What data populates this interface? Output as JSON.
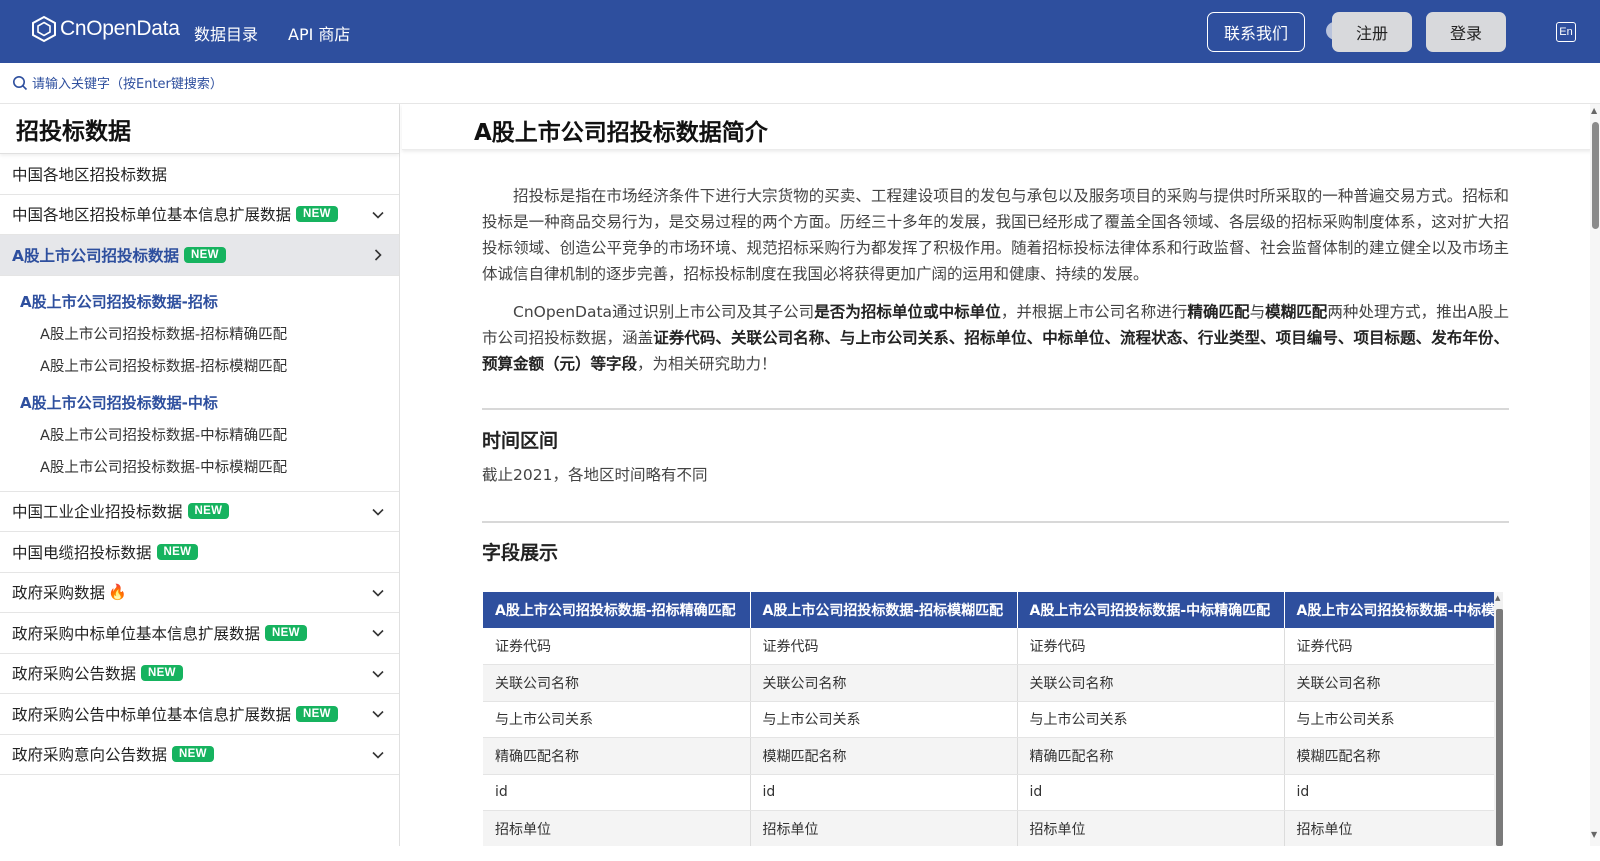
{
  "header": {
    "logo_text": "CnOpenData",
    "nav": [
      "数据目录",
      "API 商店"
    ],
    "contact_label": "联系我们",
    "register_label": "注册",
    "login_label": "登录",
    "lang_label": "En"
  },
  "search": {
    "placeholder": "请输入关键字（按Enter键搜索）"
  },
  "sidebar": {
    "title": "招投标数据",
    "badge": "NEW",
    "items": [
      {
        "label": "中国各地区招投标数据"
      },
      {
        "label": "中国各地区招投标单位基本信息扩展数据"
      },
      {
        "label": "A股上市公司招投标数据"
      },
      {
        "label": "中国工业企业招投标数据"
      },
      {
        "label": "中国电缆招投标数据"
      },
      {
        "label": "政府采购数据"
      },
      {
        "label": "政府采购中标单位基本信息扩展数据"
      },
      {
        "label": "政府采购公告数据"
      },
      {
        "label": "政府采购公告中标单位基本信息扩展数据"
      },
      {
        "label": "政府采购意向公告数据"
      }
    ],
    "submenu": {
      "group1": "A股上市公司招投标数据-招标",
      "group1_leaves": [
        "A股上市公司招投标数据-招标精确匹配",
        "A股上市公司招投标数据-招标模糊匹配"
      ],
      "group2": "A股上市公司招投标数据-中标",
      "group2_leaves": [
        "A股上市公司招投标数据-中标精确匹配",
        "A股上市公司招投标数据-中标模糊匹配"
      ]
    }
  },
  "main": {
    "title": "A股上市公司招投标数据简介",
    "para1": "招投标是指在市场经济条件下进行大宗货物的买卖、工程建设项目的发包与承包以及服务项目的采购与提供时所采取的一种普遍交易方式。招标和投标是一种商品交易行为，是交易过程的两个方面。历经三十多年的发展，我国已经形成了覆盖全国各领域、各层级的招标采购制度体系，这对扩大招投标领域、创造公平竞争的市场环境、规范招标采购行为都发挥了积极作用。随着招标投标法律体系和行政监督、社会监督体制的建立健全以及市场主体诚信自律机制的逐步完善，招标投标制度在我国必将获得更加广阔的运用和健康、持续的发展。",
    "para2": {
      "t1": "CnOpenData通过识别上市公司及其子公司",
      "b1": "是否为招标单位或中标单位",
      "t2": "，并根据上市公司名称进行",
      "b2": "精确匹配",
      "t3": "与",
      "b3": "模糊匹配",
      "t4": "两种处理方式，推出A股上市公司招投标数据，涵盖",
      "b4": "证券代码、关联公司名称、与上市公司关系、招标单位、中标单位、流程状态、行业类型、项目编号、项目标题、发布年份、预算金额（元）等字段",
      "t5": "，为相关研究助力！"
    },
    "time_heading": "时间区间",
    "time_text": "截止2021，各地区时间略有不同",
    "fields_heading": "字段展示",
    "table": {
      "headers": [
        "A股上市公司招投标数据-招标精确匹配",
        "A股上市公司招投标数据-招标模糊匹配",
        "A股上市公司招投标数据-中标精确匹配",
        "A股上市公司招投标数据-中标模糊匹配"
      ],
      "rows": [
        [
          "证券代码",
          "证券代码",
          "证券代码",
          "证券代码"
        ],
        [
          "关联公司名称",
          "关联公司名称",
          "关联公司名称",
          "关联公司名称"
        ],
        [
          "与上市公司关系",
          "与上市公司关系",
          "与上市公司关系",
          "与上市公司关系"
        ],
        [
          "精确匹配名称",
          "模糊匹配名称",
          "精确匹配名称",
          "模糊匹配名称"
        ],
        [
          "id",
          "id",
          "id",
          "id"
        ],
        [
          "招标单位",
          "招标单位",
          "招标单位",
          "招标单位"
        ]
      ]
    }
  },
  "colors": {
    "primary": "#2e4f9e",
    "badge": "#16b35f"
  }
}
